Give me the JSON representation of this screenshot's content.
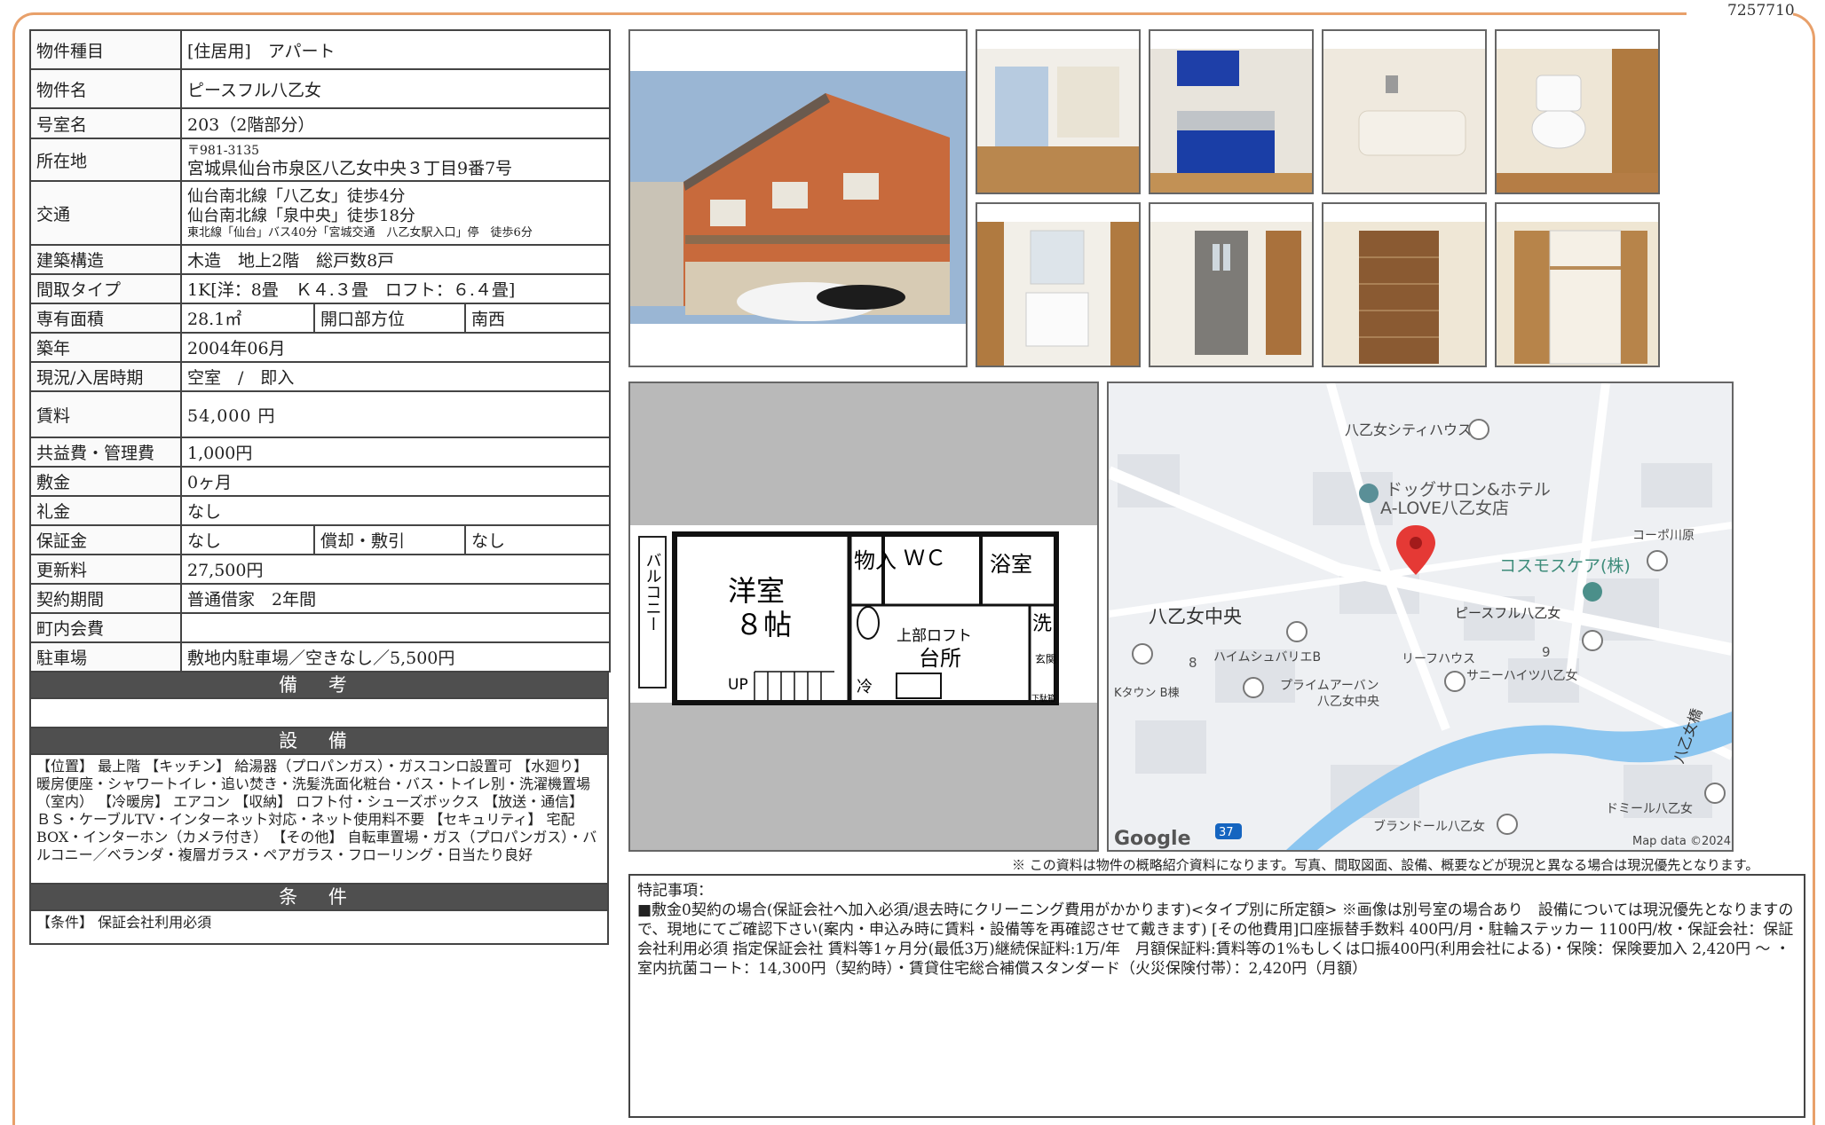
{
  "doc_number": "7257710",
  "property": {
    "type_label": "物件種目",
    "type_value": "[住居用]　アパート",
    "name_label": "物件名",
    "name_value": "ピースフル八乙女",
    "room_label": "号室名",
    "room_value": "203（2階部分）",
    "address_label": "所在地",
    "postal": "〒981-3135",
    "address_value": "宮城県仙台市泉区八乙女中央３丁目9番7号",
    "access_label": "交通",
    "access_lines": [
      "仙台南北線「八乙女」徒歩4分",
      "仙台南北線「泉中央」徒歩18分",
      "東北線「仙台」バス40分「宮城交通　八乙女駅入口」停　徒歩6分"
    ],
    "structure_label": "建築構造",
    "structure_value": "木造　地上2階　総戸数8戸",
    "layout_label": "間取タイプ",
    "layout_value": "1K[洋：8畳　Ｋ４.３畳　ロフト：６.４畳]",
    "area_label": "専有面積",
    "area_value": "28.1㎡",
    "opening_label": "開口部方位",
    "opening_value": "南西",
    "built_label": "築年",
    "built_value": "2004年06月",
    "status_label": "現況/入居時期",
    "status_value": "空室　/　即入",
    "rent_label": "賃料",
    "rent_value": "54,000 円",
    "fee_label": "共益費・管理費",
    "fee_value": "1,000円",
    "deposit_label": "敷金",
    "deposit_value": "0ヶ月",
    "key_money_label": "礼金",
    "key_money_value": "なし",
    "guarantee_label": "保証金",
    "guarantee_value": "なし",
    "amort_label": "償却・敷引",
    "amort_value": "なし",
    "renewal_label": "更新料",
    "renewal_value": "27,500円",
    "contract_label": "契約期間",
    "contract_value": "普通借家　2年間",
    "community_label": "町内会費",
    "community_value": "",
    "parking_label": "駐車場",
    "parking_value": "敷地内駐車場／空きなし／5,500円"
  },
  "sections": {
    "remarks_title": "備 考",
    "remarks_text": "",
    "equipment_title": "設 備",
    "equipment_text": "【位置】 最上階 【キッチン】 給湯器（プロパンガス）・ガスコンロ設置可 【水廻り】 暖房便座・シャワートイレ・追い焚き・洗髪洗面化粧台・バス・トイレ別・洗濯機置場（室内） 【冷暖房】 エアコン 【収納】 ロフト付・シューズボックス 【放送・通信】 ＢＳ・ケーブルTV・インターネット対応・ネット使用料不要 【セキュリティ】 宅配BOX・インターホン（カメラ付き） 【その他】 自転車置場・ガス（プロパンガス）・バルコニー／ベランダ・複層ガラス・ペアガラス・フローリング・日当たり良好",
    "conditions_title": "条 件",
    "conditions_text": "【条件】 保証会社利用必須"
  },
  "floorplan": {
    "balcony": "バルコニー",
    "room_name": "洋室",
    "room_size": "８帖",
    "storage": "物入",
    "wc": "ＷＣ",
    "bath": "浴室",
    "wash": "洗",
    "loft": "上部ロフト",
    "kitchen": "台所",
    "entrance": "玄関",
    "fridge": "冷",
    "up": "UP",
    "shoe": "下駄箱"
  },
  "map": {
    "places": [
      "八乙女シティハウス",
      "ドッグサロン&ホテル",
      "A-LOVE八乙女店",
      "コーポ川原",
      "コスモスケア(株)",
      "八乙女中央",
      "ピースフル八乙女",
      "ハイムシュバリエB",
      "リーフハウス",
      "サニーハイツ八乙女",
      "Kタウン B棟",
      "プライムアーバン",
      "八乙女中央",
      "八乙女橋",
      "ドミール八乙女",
      "ブランドール八乙女"
    ],
    "numbers": [
      "8",
      "9"
    ],
    "route": "37",
    "brand": "Google",
    "credit": "Map data ©2024"
  },
  "notice": "※ この資料は物件の概略紹介資料になります。写真、間取図面、設備、概要などが現況と異なる場合は現況優先となります。",
  "special": {
    "heading": "特記事項：",
    "body": "■敷金0契約の場合(保証会社へ加入必須/退去時にクリーニング費用がかかります)<タイプ別に所定額> ※画像は別号室の場合あり　設備については現況優先となりますので、現地にてご確認下さい(案内・申込み時に賃料・設備等を再確認させて戴きます) [その他費用]口座振替手数料 400円/月・駐輪ステッカー 1100円/枚・保証会社：保証会社利用必須 指定保証会社 賃料等1ヶ月分(最低3万)継続保証料:1万/年　月額保証料:賃料等の1%もしくは口振400円(利用会社による)・保険：保険要加入 2,420円 〜 ・室内抗菌コート：14,300円（契約時）・賃貸住宅総合補償スタンダード（火災保険付帯）：2,420円（月額）"
  }
}
